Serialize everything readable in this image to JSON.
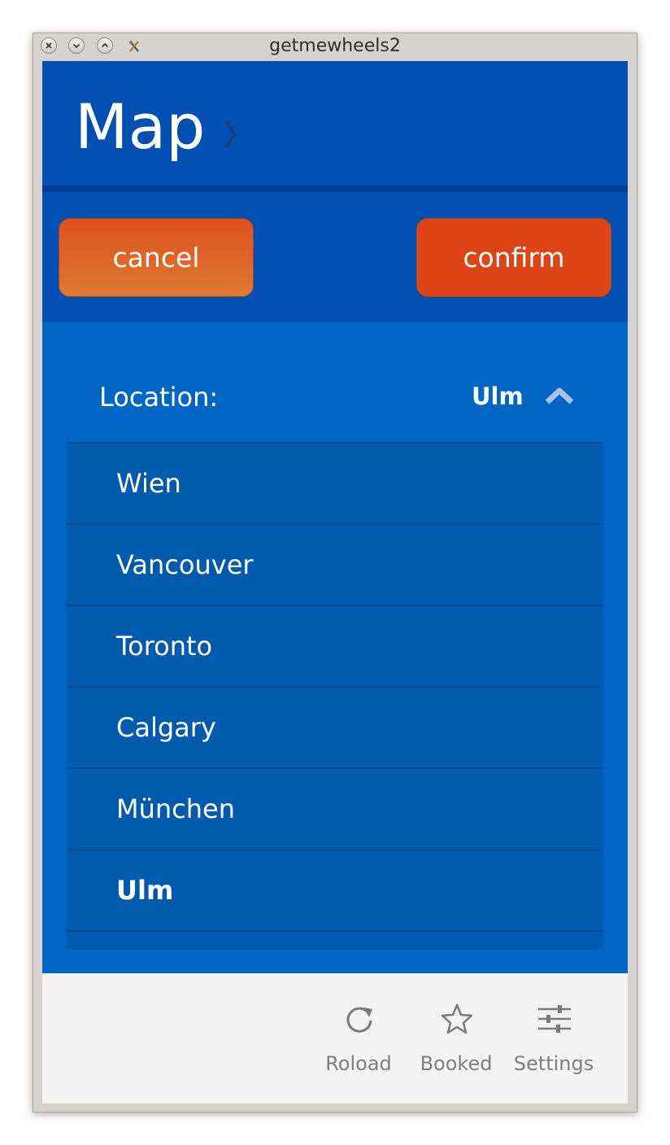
{
  "window": {
    "title": "getmewheels2"
  },
  "header": {
    "title": "Map"
  },
  "actions": {
    "cancel_label": "cancel",
    "confirm_label": "confirm"
  },
  "location": {
    "label": "Location:",
    "value": "Ulm",
    "options": [
      "Wien",
      "Vancouver",
      "Toronto",
      "Calgary",
      "München",
      "Ulm"
    ],
    "selected_index": 5
  },
  "tabs": [
    {
      "label": "Roload",
      "icon": "reload-icon"
    },
    {
      "label": "Booked",
      "icon": "star-icon"
    },
    {
      "label": "Settings",
      "icon": "sliders-icon"
    }
  ],
  "colors": {
    "header": "#004fb5",
    "content": "#0066c5",
    "dropdown": "#005aad",
    "button_orange": "#de4516",
    "bottom_bar": "#f4f4f4"
  }
}
